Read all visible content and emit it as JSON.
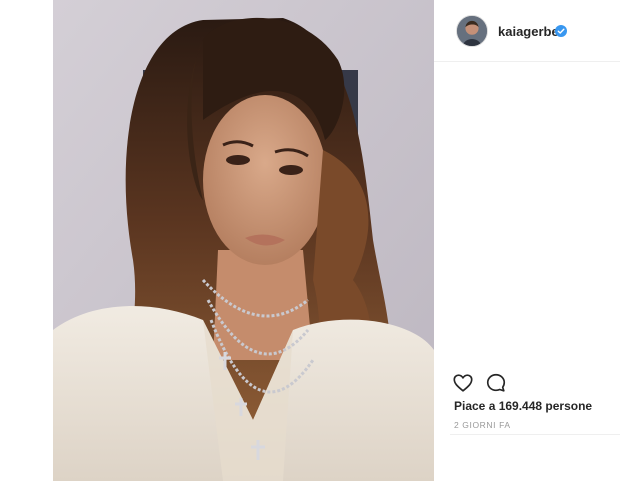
{
  "post": {
    "username": "kaiagerber",
    "likes_text": "Piace a 169.448 persone",
    "time_ago": "2 GIORNI FA"
  },
  "icons": {
    "like": "heart-icon",
    "comment": "comment-icon",
    "verified": "verified-badge-icon"
  },
  "colors": {
    "verified": "#3897f0",
    "text": "#262626",
    "muted": "#999999",
    "divider": "#efefef"
  }
}
